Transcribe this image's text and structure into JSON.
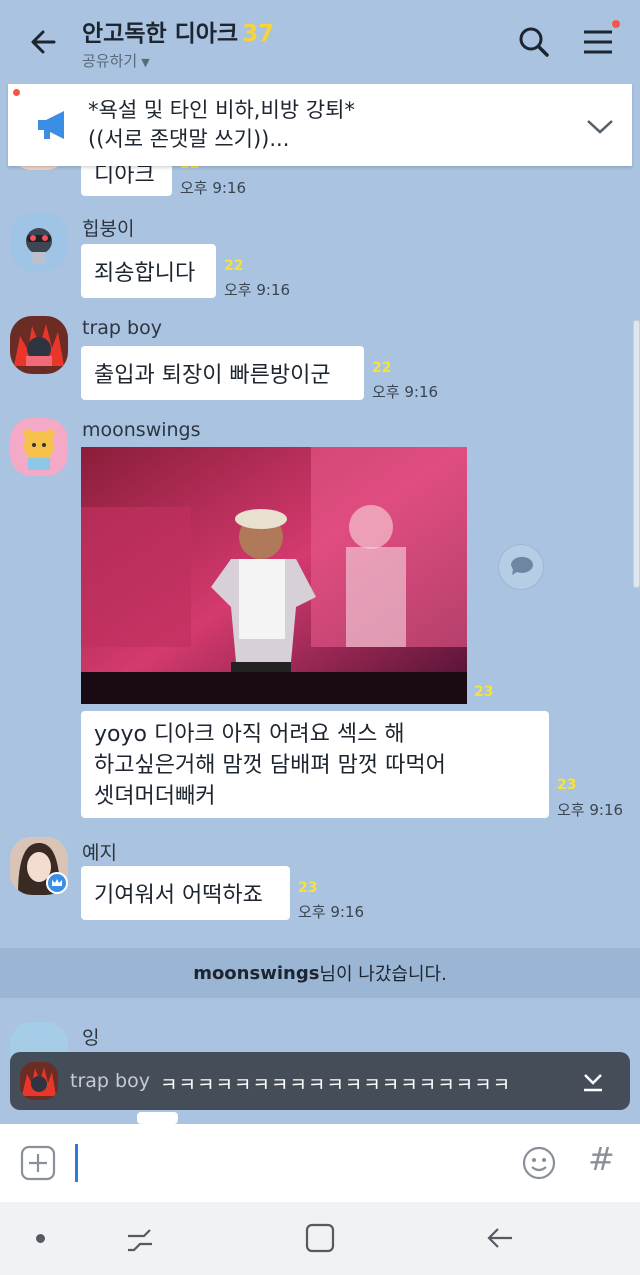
{
  "header": {
    "title": "안고독한 디아크",
    "member_count": "37",
    "share_label": "공유하기",
    "caret": "▼"
  },
  "notice": {
    "line1": "*욕설 및 타인 비하,비방 강퇴*",
    "line2": "((서로 존댓말 쓰기))..."
  },
  "messages": [
    {
      "sender": "",
      "text": "디아크",
      "unread": "22",
      "time": "오후 9:16"
    },
    {
      "sender": "힙붕이",
      "text": "죄송합니다",
      "unread": "22",
      "time": "오후 9:16"
    },
    {
      "sender": "trap boy",
      "text": "출입과 퇴장이 빠른방이군",
      "unread": "22",
      "time": "오후 9:16"
    },
    {
      "sender": "moonswings",
      "photo_unread": "23",
      "lines": [
        "yoyo 디아크 아직 어려요 섹스 해",
        "하고싶은거해 맘껏 담배펴 맘껏 따먹어",
        "셋뎌머더빼커"
      ],
      "unread": "23",
      "time": "오후 9:16"
    },
    {
      "sender": "예지",
      "text": "기여워서 어떡하죠",
      "unread": "23",
      "time": "오후 9:16"
    },
    {
      "sender": "잉"
    }
  ],
  "system_message": {
    "user": "moonswings",
    "suffix": "님이 나갔습니다."
  },
  "floating_preview": {
    "name": "trap boy",
    "text": "ㅋㅋㅋㅋㅋㅋㅋㅋㅋㅋㅋㅋㅋㅋㅋㅋㅋㅋㅋ"
  },
  "input": {
    "hash": "#"
  },
  "colors": {
    "background": "#a9c3e0",
    "unread": "#f7e23c",
    "accent_dot": "#f2584a"
  }
}
